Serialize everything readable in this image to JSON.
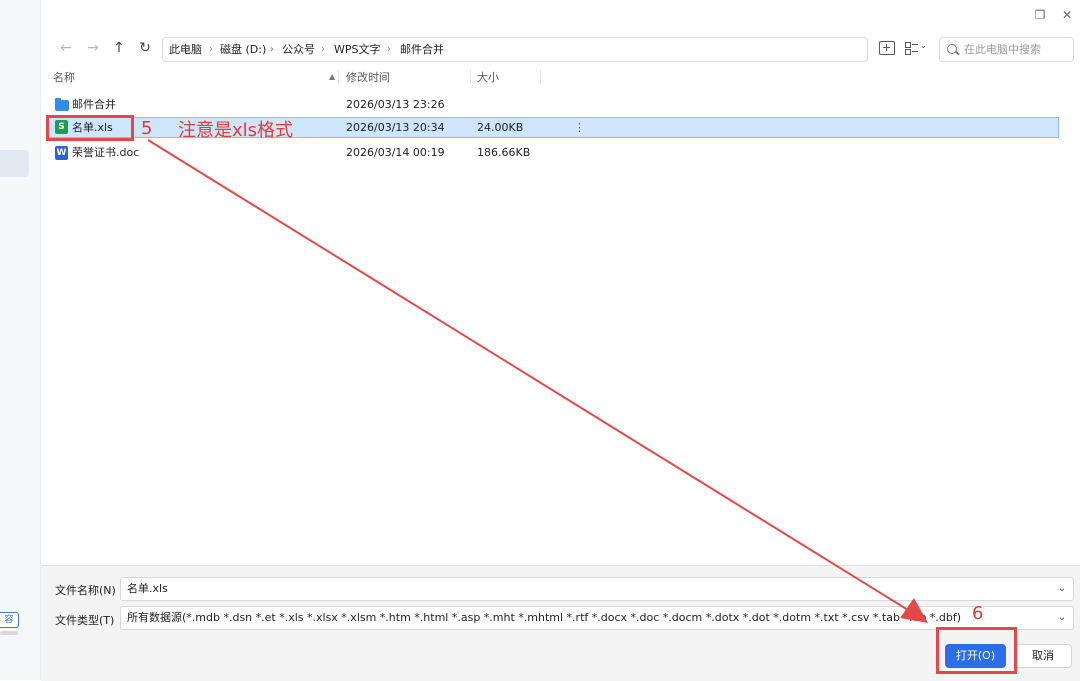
{
  "window": {
    "restore_glyph": "❐",
    "close_glyph": "✕"
  },
  "nav": {
    "back_glyph": "←",
    "forward_glyph": "→",
    "up_glyph": "↑",
    "refresh_glyph": "↻"
  },
  "breadcrumb": [
    "此电脑",
    "磁盘 (D:)",
    "公众号",
    "WPS文字",
    "邮件合并"
  ],
  "search": {
    "placeholder": "在此电脑中搜索"
  },
  "columns": {
    "name": "名称",
    "modified": "修改时间",
    "size": "大小"
  },
  "files": [
    {
      "name": "邮件合并",
      "modified": "2026/03/13 23:26",
      "size": "",
      "icon": "folder-icon",
      "icon_text": ""
    },
    {
      "name": "名单.xls",
      "modified": "2026/03/13 20:34",
      "size": "24.00KB",
      "icon": "spreadsheet-icon",
      "icon_text": "S",
      "selected": true,
      "more": "⋮"
    },
    {
      "name": "荣誉证书.doc",
      "modified": "2026/03/14 00:19",
      "size": "186.66KB",
      "icon": "word-doc-icon",
      "icon_text": "W"
    }
  ],
  "bottom": {
    "filename_label": "文件名称(N)",
    "filename_value": "名单.xls",
    "filetype_label": "文件类型(T)",
    "filetype_value": "所有数据源(*.mdb *.dsn *.et *.xls *.xlsx *.xlsm *.htm *.html *.asp *.mht *.mhtml *.rtf *.docx *.doc *.docm *.dotx *.dot *.dotm *.txt *.csv *.tab *.db *.dbf)",
    "open_label": "打开(O)",
    "cancel_label": "取消"
  },
  "left_strip": {
    "button_text": "容"
  },
  "annotations": {
    "step5": "5",
    "step5_note": "注意是xls格式",
    "step6": "6"
  },
  "colors": {
    "accent": "#2c6ee6",
    "selection": "#cde6fb",
    "annotation_red": "#e24a4a",
    "excel_green": "#1f9d55",
    "word_blue": "#2b63d9"
  }
}
